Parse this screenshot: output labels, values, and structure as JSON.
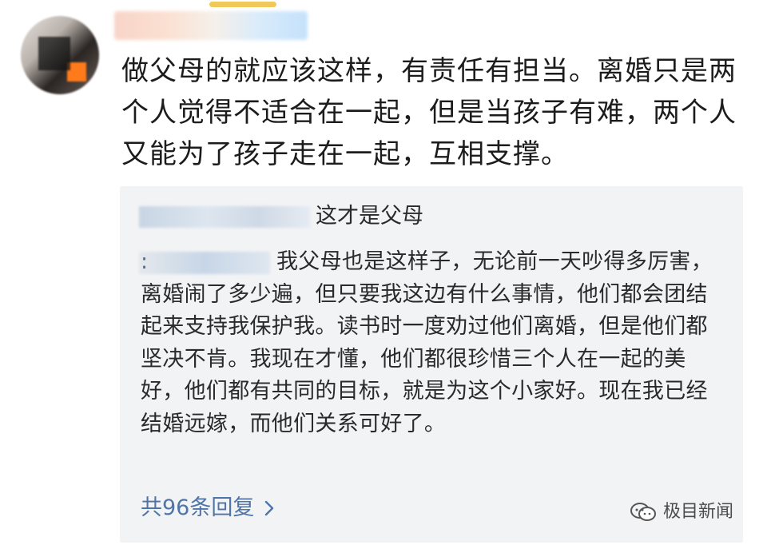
{
  "comment": {
    "text": "做父母的就应该这样，有责任有担当。离婚只是两个人觉得不适合在一起，但是当孩子有难，两个人又能为了孩子走在一起，互相支撑。"
  },
  "replies": {
    "first": {
      "text": "这才是父母"
    },
    "second": {
      "prefix": ":",
      "text": "我父母也是这样子，无论前一天吵得多厉害，离婚闹了多少遍，但只要我这边有什么事情，他们都会团结起来支持我保护我。读书时一度劝过他们离婚，但是他们都坚决不肯。我现在才懂，他们都很珍惜三个人在一起的美好，他们都有共同的目标，就是为这个小家好。现在我已经结婚远嫁，而他们关系可好了。"
    },
    "more_label": "共96条回复"
  },
  "watermark": {
    "text": "极目新闻",
    "icon": "wechat-icon"
  },
  "colors": {
    "link": "#4f75a8",
    "reply_bg": "#f2f3f5",
    "text": "#1c1c1c"
  }
}
